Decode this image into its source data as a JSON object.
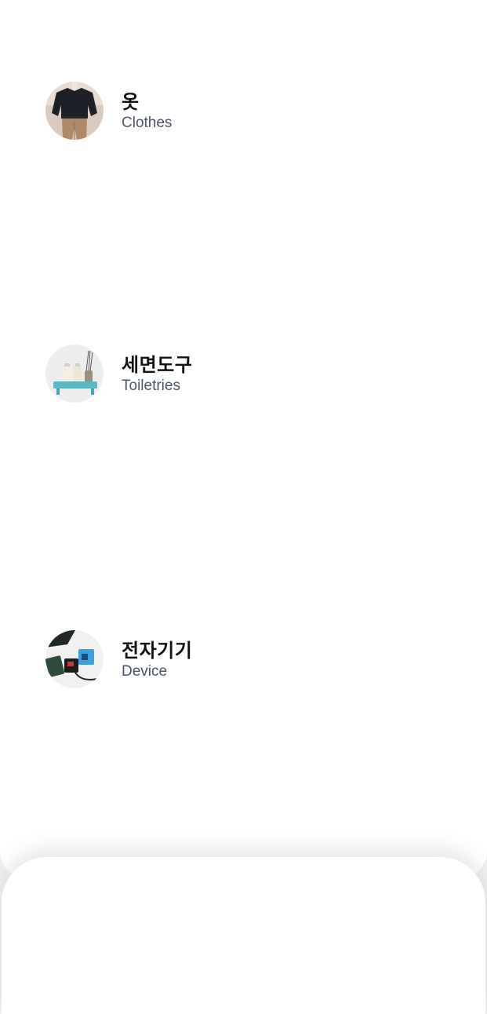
{
  "categories": [
    {
      "id": "clothes",
      "title": "옷",
      "subtitle": "Clothes",
      "icon": "clothes-photo"
    },
    {
      "id": "toiletries",
      "title": "세면도구",
      "subtitle": "Toiletries",
      "icon": "toiletries-photo"
    },
    {
      "id": "device",
      "title": "전자기기",
      "subtitle": "Device",
      "icon": "device-photo"
    }
  ],
  "colors": {
    "title": "#111111",
    "subtitle": "#4b5568",
    "background": "#ffffff"
  }
}
